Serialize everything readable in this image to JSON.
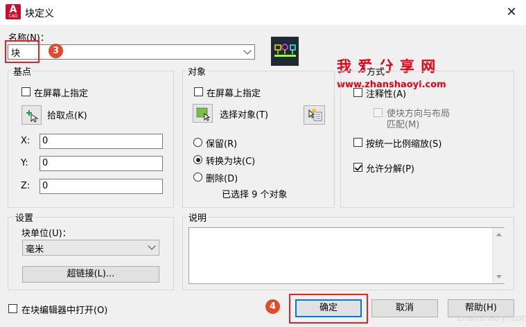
{
  "window": {
    "title": "块定义",
    "close": "✕",
    "app_icon_letter": "A",
    "app_icon_sub": "CAD"
  },
  "name": {
    "label": "名称(N)：",
    "value": "块"
  },
  "base_point": {
    "title": "基点",
    "specify_on_screen": "在屏幕上指定",
    "pick_point": "拾取点(K)",
    "x_label": "X:",
    "y_label": "Y:",
    "z_label": "Z:",
    "x": "0",
    "y": "0",
    "z": "0"
  },
  "objects": {
    "title": "对象",
    "specify_on_screen": "在屏幕上指定",
    "select_objects": "选择对象(T)",
    "retain": "保留(R)",
    "convert": "转换为块(C)",
    "delete": "删除(D)",
    "selected_count": "已选择 9 个对象"
  },
  "behavior": {
    "title": "方式",
    "annotative": "注释性(A)",
    "match_orientation_line1": "使块方向与布局",
    "match_orientation_line2": "匹配(M)",
    "scale_uniformly": "按统一比例缩放(S)",
    "allow_exploding": "允许分解(P)"
  },
  "settings": {
    "title": "设置",
    "block_unit_label": "块单位(U)：",
    "block_unit_value": "毫米",
    "hyperlink": "超链接(L)..."
  },
  "description": {
    "title": "说明",
    "value": ""
  },
  "footer": {
    "open_in_editor": "在块编辑器中打开(O)",
    "ok": "确定",
    "cancel": "取消",
    "help": "帮助(H)"
  },
  "annotations": {
    "step3": "3",
    "step4": "4"
  },
  "watermark": {
    "title": "我 爱 分 享 网",
    "url": "www.zhanshaoyi.com",
    "footer_url": "zhanshaoyi.com"
  },
  "colors": {
    "accent": "#0078d7",
    "annotation_red": "#e0242a",
    "badge": "#e34a2a",
    "watermark": "#e60012"
  }
}
